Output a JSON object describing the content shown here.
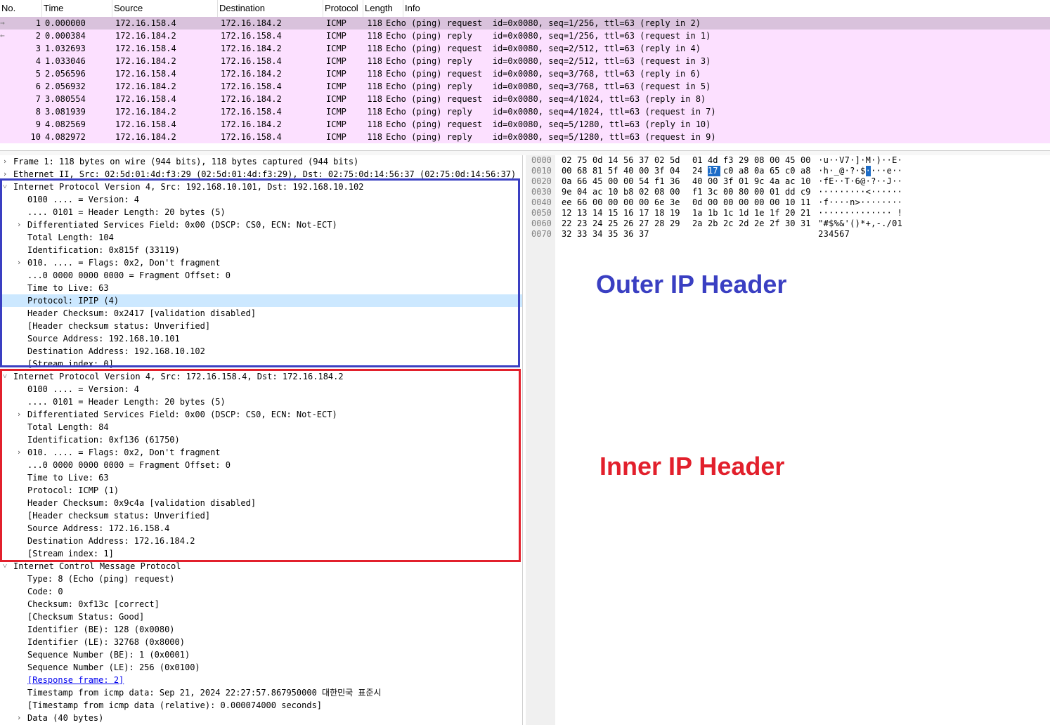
{
  "colors": {
    "row_bg": "#fce0ff",
    "row_selected_bg": "#d9c2dc",
    "field_highlight_bg": "#cce8ff",
    "byte_selected_bg": "#1d6cc7",
    "outer_accent": "#3a3fc2",
    "inner_accent": "#e2202c"
  },
  "packet_list": {
    "columns": [
      "No.",
      "Time",
      "Source",
      "Destination",
      "Protocol",
      "Length",
      "Info"
    ],
    "rows": [
      {
        "arrow": "→",
        "no": "1",
        "time": "0.000000",
        "src": "172.16.158.4",
        "dst": "172.16.184.2",
        "proto": "ICMP",
        "len": "118",
        "info": "Echo (ping) request  id=0x0080, seq=1/256, ttl=63 (reply in 2)"
      },
      {
        "arrow": "←",
        "no": "2",
        "time": "0.000384",
        "src": "172.16.184.2",
        "dst": "172.16.158.4",
        "proto": "ICMP",
        "len": "118",
        "info": "Echo (ping) reply    id=0x0080, seq=1/256, ttl=63 (request in 1)"
      },
      {
        "arrow": "",
        "no": "3",
        "time": "1.032693",
        "src": "172.16.158.4",
        "dst": "172.16.184.2",
        "proto": "ICMP",
        "len": "118",
        "info": "Echo (ping) request  id=0x0080, seq=2/512, ttl=63 (reply in 4)"
      },
      {
        "arrow": "",
        "no": "4",
        "time": "1.033046",
        "src": "172.16.184.2",
        "dst": "172.16.158.4",
        "proto": "ICMP",
        "len": "118",
        "info": "Echo (ping) reply    id=0x0080, seq=2/512, ttl=63 (request in 3)"
      },
      {
        "arrow": "",
        "no": "5",
        "time": "2.056596",
        "src": "172.16.158.4",
        "dst": "172.16.184.2",
        "proto": "ICMP",
        "len": "118",
        "info": "Echo (ping) request  id=0x0080, seq=3/768, ttl=63 (reply in 6)"
      },
      {
        "arrow": "",
        "no": "6",
        "time": "2.056932",
        "src": "172.16.184.2",
        "dst": "172.16.158.4",
        "proto": "ICMP",
        "len": "118",
        "info": "Echo (ping) reply    id=0x0080, seq=3/768, ttl=63 (request in 5)"
      },
      {
        "arrow": "",
        "no": "7",
        "time": "3.080554",
        "src": "172.16.158.4",
        "dst": "172.16.184.2",
        "proto": "ICMP",
        "len": "118",
        "info": "Echo (ping) request  id=0x0080, seq=4/1024, ttl=63 (reply in 8)"
      },
      {
        "arrow": "",
        "no": "8",
        "time": "3.081939",
        "src": "172.16.184.2",
        "dst": "172.16.158.4",
        "proto": "ICMP",
        "len": "118",
        "info": "Echo (ping) reply    id=0x0080, seq=4/1024, ttl=63 (request in 7)"
      },
      {
        "arrow": "",
        "no": "9",
        "time": "4.082569",
        "src": "172.16.158.4",
        "dst": "172.16.184.2",
        "proto": "ICMP",
        "len": "118",
        "info": "Echo (ping) request  id=0x0080, seq=5/1280, ttl=63 (reply in 10)"
      },
      {
        "arrow": "",
        "no": "10",
        "time": "4.082972",
        "src": "172.16.184.2",
        "dst": "172.16.158.4",
        "proto": "ICMP",
        "len": "118",
        "info": "Echo (ping) reply    id=0x0080, seq=5/1280, ttl=63 (request in 9)"
      }
    ]
  },
  "details": {
    "rows": [
      {
        "depth": 0,
        "toggle": "›",
        "text": "Frame 1: 118 bytes on wire (944 bits), 118 bytes captured (944 bits)"
      },
      {
        "depth": 0,
        "toggle": "›",
        "text": "Ethernet II, Src: 02:5d:01:4d:f3:29 (02:5d:01:4d:f3:29), Dst: 02:75:0d:14:56:37 (02:75:0d:14:56:37)"
      },
      {
        "depth": 0,
        "toggle": "˅",
        "text": "Internet Protocol Version 4, Src: 192.168.10.101, Dst: 192.168.10.102"
      },
      {
        "depth": 1,
        "toggle": "",
        "text": "0100 .... = Version: 4"
      },
      {
        "depth": 1,
        "toggle": "",
        "text": ".... 0101 = Header Length: 20 bytes (5)"
      },
      {
        "depth": 1,
        "toggle": "›",
        "text": "Differentiated Services Field: 0x00 (DSCP: CS0, ECN: Not-ECT)"
      },
      {
        "depth": 1,
        "toggle": "",
        "text": "Total Length: 104"
      },
      {
        "depth": 1,
        "toggle": "",
        "text": "Identification: 0x815f (33119)"
      },
      {
        "depth": 1,
        "toggle": "›",
        "text": "010. .... = Flags: 0x2, Don't fragment"
      },
      {
        "depth": 1,
        "toggle": "",
        "text": "...0 0000 0000 0000 = Fragment Offset: 0"
      },
      {
        "depth": 1,
        "toggle": "",
        "text": "Time to Live: 63"
      },
      {
        "depth": 1,
        "toggle": "",
        "text": "Protocol: IPIP (4)",
        "highlight": true
      },
      {
        "depth": 1,
        "toggle": "",
        "text": "Header Checksum: 0x2417 [validation disabled]"
      },
      {
        "depth": 1,
        "toggle": "",
        "text": "[Header checksum status: Unverified]"
      },
      {
        "depth": 1,
        "toggle": "",
        "text": "Source Address: 192.168.10.101"
      },
      {
        "depth": 1,
        "toggle": "",
        "text": "Destination Address: 192.168.10.102"
      },
      {
        "depth": 1,
        "toggle": "",
        "text": "[Stream index: 0]"
      },
      {
        "depth": 0,
        "toggle": "˅",
        "text": "Internet Protocol Version 4, Src: 172.16.158.4, Dst: 172.16.184.2"
      },
      {
        "depth": 1,
        "toggle": "",
        "text": "0100 .... = Version: 4"
      },
      {
        "depth": 1,
        "toggle": "",
        "text": ".... 0101 = Header Length: 20 bytes (5)"
      },
      {
        "depth": 1,
        "toggle": "›",
        "text": "Differentiated Services Field: 0x00 (DSCP: CS0, ECN: Not-ECT)"
      },
      {
        "depth": 1,
        "toggle": "",
        "text": "Total Length: 84"
      },
      {
        "depth": 1,
        "toggle": "",
        "text": "Identification: 0xf136 (61750)"
      },
      {
        "depth": 1,
        "toggle": "›",
        "text": "010. .... = Flags: 0x2, Don't fragment"
      },
      {
        "depth": 1,
        "toggle": "",
        "text": "...0 0000 0000 0000 = Fragment Offset: 0"
      },
      {
        "depth": 1,
        "toggle": "",
        "text": "Time to Live: 63"
      },
      {
        "depth": 1,
        "toggle": "",
        "text": "Protocol: ICMP (1)"
      },
      {
        "depth": 1,
        "toggle": "",
        "text": "Header Checksum: 0x9c4a [validation disabled]"
      },
      {
        "depth": 1,
        "toggle": "",
        "text": "[Header checksum status: Unverified]"
      },
      {
        "depth": 1,
        "toggle": "",
        "text": "Source Address: 172.16.158.4"
      },
      {
        "depth": 1,
        "toggle": "",
        "text": "Destination Address: 172.16.184.2"
      },
      {
        "depth": 1,
        "toggle": "",
        "text": "[Stream index: 1]"
      },
      {
        "depth": 0,
        "toggle": "˅",
        "text": "Internet Control Message Protocol"
      },
      {
        "depth": 1,
        "toggle": "",
        "text": "Type: 8 (Echo (ping) request)"
      },
      {
        "depth": 1,
        "toggle": "",
        "text": "Code: 0"
      },
      {
        "depth": 1,
        "toggle": "",
        "text": "Checksum: 0xf13c [correct]"
      },
      {
        "depth": 1,
        "toggle": "",
        "text": "[Checksum Status: Good]"
      },
      {
        "depth": 1,
        "toggle": "",
        "text": "Identifier (BE): 128 (0x0080)"
      },
      {
        "depth": 1,
        "toggle": "",
        "text": "Identifier (LE): 32768 (0x8000)"
      },
      {
        "depth": 1,
        "toggle": "",
        "text": "Sequence Number (BE): 1 (0x0001)"
      },
      {
        "depth": 1,
        "toggle": "",
        "text": "Sequence Number (LE): 256 (0x0100)"
      },
      {
        "depth": 1,
        "toggle": "",
        "text": "[Response frame: 2]",
        "link": true
      },
      {
        "depth": 1,
        "toggle": "",
        "text": "Timestamp from icmp data: Sep 21, 2024 22:27:57.867950000 대한민국 표준시"
      },
      {
        "depth": 1,
        "toggle": "",
        "text": "[Timestamp from icmp data (relative): 0.000074000 seconds]"
      },
      {
        "depth": 1,
        "toggle": "›",
        "text": "Data (40 bytes)"
      }
    ]
  },
  "hex": {
    "selected_byte": {
      "row": 1,
      "col": 9
    },
    "rows": [
      {
        "offset": "0000",
        "bytes": [
          "02",
          "75",
          "0d",
          "14",
          "56",
          "37",
          "02",
          "5d",
          "01",
          "4d",
          "f3",
          "29",
          "08",
          "00",
          "45",
          "00"
        ],
        "ascii": "·u··V7·]·M·)··E·"
      },
      {
        "offset": "0010",
        "bytes": [
          "00",
          "68",
          "81",
          "5f",
          "40",
          "00",
          "3f",
          "04",
          "24",
          "17",
          "c0",
          "a8",
          "0a",
          "65",
          "c0",
          "a8"
        ],
        "ascii": "·h·_@·?·$····e··"
      },
      {
        "offset": "0020",
        "bytes": [
          "0a",
          "66",
          "45",
          "00",
          "00",
          "54",
          "f1",
          "36",
          "40",
          "00",
          "3f",
          "01",
          "9c",
          "4a",
          "ac",
          "10"
        ],
        "ascii": "·fE··T·6@·?··J··"
      },
      {
        "offset": "0030",
        "bytes": [
          "9e",
          "04",
          "ac",
          "10",
          "b8",
          "02",
          "08",
          "00",
          "f1",
          "3c",
          "00",
          "80",
          "00",
          "01",
          "dd",
          "c9"
        ],
        "ascii": "·········<······"
      },
      {
        "offset": "0040",
        "bytes": [
          "ee",
          "66",
          "00",
          "00",
          "00",
          "00",
          "6e",
          "3e",
          "0d",
          "00",
          "00",
          "00",
          "00",
          "00",
          "10",
          "11"
        ],
        "ascii": "·f····n>········"
      },
      {
        "offset": "0050",
        "bytes": [
          "12",
          "13",
          "14",
          "15",
          "16",
          "17",
          "18",
          "19",
          "1a",
          "1b",
          "1c",
          "1d",
          "1e",
          "1f",
          "20",
          "21"
        ],
        "ascii": "·············· !"
      },
      {
        "offset": "0060",
        "bytes": [
          "22",
          "23",
          "24",
          "25",
          "26",
          "27",
          "28",
          "29",
          "2a",
          "2b",
          "2c",
          "2d",
          "2e",
          "2f",
          "30",
          "31"
        ],
        "ascii": "\"#$%&'()*+,-./01"
      },
      {
        "offset": "0070",
        "bytes": [
          "32",
          "33",
          "34",
          "35",
          "36",
          "37"
        ],
        "ascii": "234567"
      }
    ]
  },
  "annotations": {
    "outer_label": "Outer IP Header",
    "inner_label": "Inner IP Header"
  }
}
